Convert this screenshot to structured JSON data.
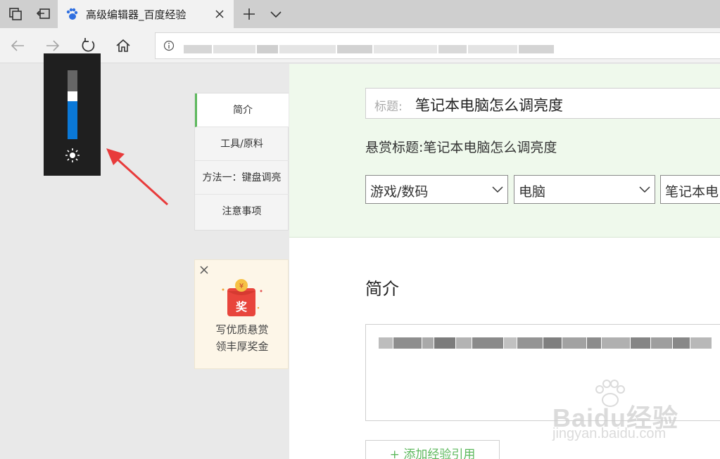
{
  "browser": {
    "tab_title": "高级编辑器_百度经验",
    "url_obscured": true
  },
  "brightness": {
    "level": 0.55
  },
  "toc": {
    "items": [
      "简介",
      "工具/原料",
      "方法一：键盘调亮",
      "注意事项"
    ],
    "active_index": 0
  },
  "promo": {
    "line1": "写优质悬赏",
    "line2": "领丰厚奖金",
    "badge": "奖"
  },
  "editor": {
    "title_label": "标题:",
    "title_value": "笔记本电脑怎么调亮度",
    "reward_label": "悬赏标题:",
    "reward_value": "笔记本电脑怎么调亮度",
    "categories": [
      "游戏/数码",
      "电脑",
      "笔记本电"
    ],
    "section_heading": "简介",
    "add_reference_label": "+ 添加经验引用"
  },
  "watermark": {
    "brand": "Baidu经验",
    "url": "jingyan.baidu.com"
  },
  "colors": {
    "accent_green": "#5cb85c",
    "brightness_blue": "#0a78d7",
    "panel_bg": "#eff9ec"
  }
}
